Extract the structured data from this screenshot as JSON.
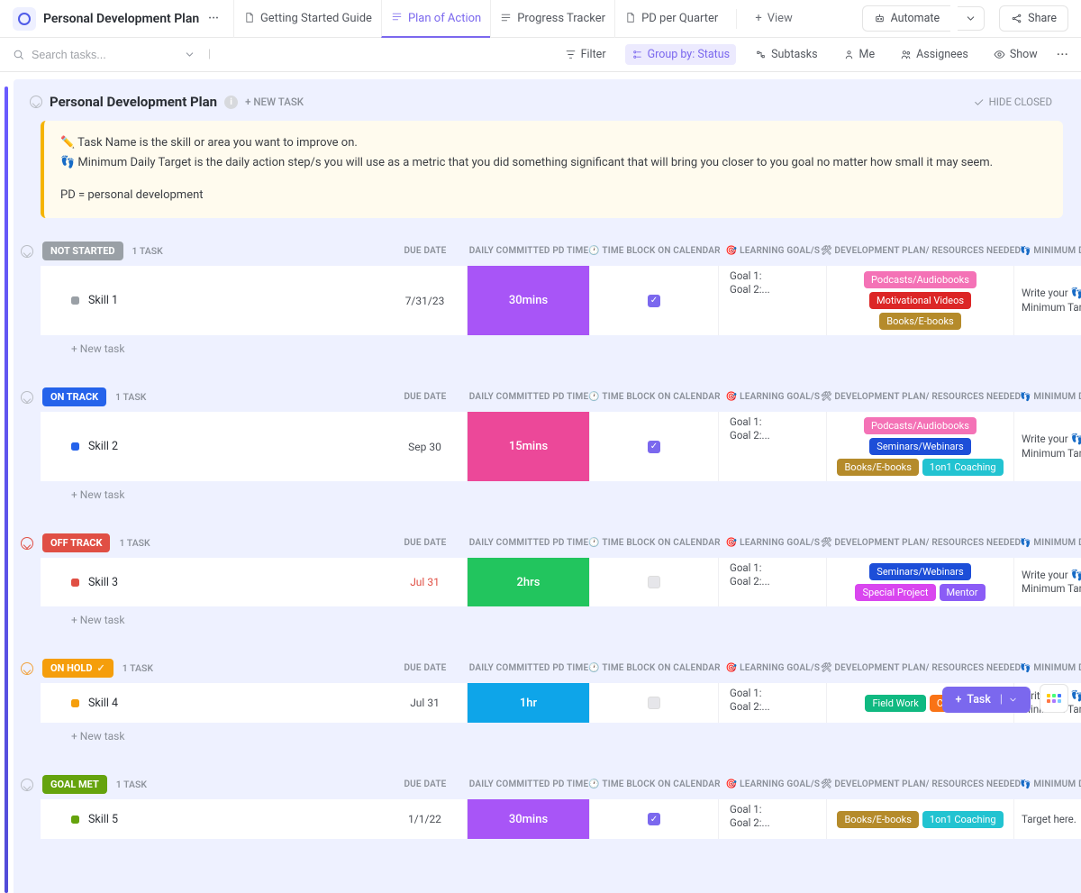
{
  "nav": {
    "title": "Personal Development Plan",
    "tabs": [
      {
        "icon": "doc",
        "label": "Getting Started Guide"
      },
      {
        "icon": "list",
        "label": "Plan of Action",
        "active": true
      },
      {
        "icon": "list",
        "label": "Progress Tracker"
      },
      {
        "icon": "doc",
        "label": "PD per Quarter"
      }
    ],
    "add_view": "View",
    "automate": "Automate",
    "share": "Share"
  },
  "toolbar": {
    "search_placeholder": "Search tasks...",
    "filter": "Filter",
    "group_by": "Group by: Status",
    "subtasks": "Subtasks",
    "me": "Me",
    "assignees": "Assignees",
    "show": "Show"
  },
  "section": {
    "title": "Personal Development Plan",
    "new_task": "+ NEW TASK",
    "hide_closed": "HIDE CLOSED"
  },
  "info_box": {
    "line1": "✏️ Task Name is the skill or area you want to improve on.",
    "line2": "👣 Minimum Daily Target is the daily action step/s you will use as a metric that you did something significant that will bring you closer to you goal no matter how small it may seem.",
    "line3": "PD = personal development"
  },
  "columns": {
    "due_date": "DUE DATE",
    "pd_time": "DAILY COMMITTED PD TIME",
    "time_block": "🕐 TIME BLOCK ON CALENDAR",
    "goals": "🎯 LEARNING GOAL/S",
    "resources": "🛠 DEVELOPMENT PLAN/ RESOURCES NEEDED",
    "min_target": "👣 MINIMUM DAILY"
  },
  "add_task_label": "+ New task",
  "task_count_label_1": "1 TASK",
  "groups": [
    {
      "status": "NOT STARTED",
      "status_color": "#9aa0a6",
      "collapse_class": "",
      "task": {
        "name": "Skill 1",
        "sq_color": "#9aa0a6",
        "date": "7/31/23",
        "overdue": false,
        "time": "30mins",
        "time_bg": "#a855f7",
        "checked": true,
        "goals": [
          "Goal 1:",
          "Goal 2:..."
        ],
        "resources": [
          {
            "label": "Podcasts/Audiobooks",
            "color": "#f472b6"
          },
          {
            "label": "Motivational Videos",
            "color": "#dc2626"
          },
          {
            "label": "Books/E-books",
            "color": "#b58b2b"
          }
        ],
        "min_target": "Write your 👣 Minimum Target here."
      }
    },
    {
      "status": "ON TRACK",
      "status_color": "#2563eb",
      "collapse_class": "",
      "task": {
        "name": "Skill 2",
        "sq_color": "#2563eb",
        "date": "Sep 30",
        "overdue": false,
        "time": "15mins",
        "time_bg": "#ec4899",
        "checked": true,
        "goals": [
          "Goal 1:",
          "Goal 2:..."
        ],
        "resources": [
          {
            "label": "Podcasts/Audiobooks",
            "color": "#f472b6"
          },
          {
            "label": "Seminars/Webinars",
            "color": "#1d4ed8"
          },
          {
            "label": "Books/E-books",
            "color": "#b58b2b"
          },
          {
            "label": "1on1 Coaching",
            "color": "#22c3d1"
          }
        ],
        "min_target": "Write your 👣 Minimum Target here."
      }
    },
    {
      "status": "OFF TRACK",
      "status_color": "#e04f44",
      "collapse_class": "red",
      "task": {
        "name": "Skill 3",
        "sq_color": "#e04f44",
        "date": "Jul 31",
        "overdue": true,
        "time": "2hrs",
        "time_bg": "#22c55e",
        "checked": false,
        "goals": [
          "Goal 1:",
          "Goal 2:..."
        ],
        "resources": [
          {
            "label": "Seminars/Webinars",
            "color": "#1d4ed8"
          },
          {
            "label": "Special Project",
            "color": "#d946ef"
          },
          {
            "label": "Mentor",
            "color": "#8b5cf6"
          }
        ],
        "min_target": "Write your 👣 Minimum Target here."
      }
    },
    {
      "status": "ON HOLD",
      "status_color": "#f59e0b",
      "collapse_class": "orange",
      "status_icon": "✓",
      "task": {
        "name": "Skill 4",
        "sq_color": "#f59e0b",
        "date": "Jul 31",
        "overdue": false,
        "time": "1hr",
        "time_bg": "#0ea5e9",
        "checked": false,
        "goals": [
          "Goal 1:",
          "Goal 2:..."
        ],
        "resources": [
          {
            "label": "Field Work",
            "color": "#10b981"
          },
          {
            "label": "Course",
            "color": "#f97316"
          }
        ],
        "min_target": "Write your 👣 Minimum Target here."
      }
    },
    {
      "status": "GOAL MET",
      "status_color": "#65a30d",
      "collapse_class": "",
      "no_add": true,
      "task": {
        "name": "Skill 5",
        "sq_color": "#65a30d",
        "date": "1/1/22",
        "overdue": false,
        "time": "30mins",
        "time_bg": "#a855f7",
        "checked": true,
        "goals": [
          "Goal 1:",
          "Goal 2:..."
        ],
        "resources": [
          {
            "label": "Books/E-books",
            "color": "#b58b2b"
          },
          {
            "label": "1on1 Coaching",
            "color": "#22c3d1"
          }
        ],
        "min_target": "Target here."
      }
    }
  ],
  "float": {
    "task": "Task"
  }
}
